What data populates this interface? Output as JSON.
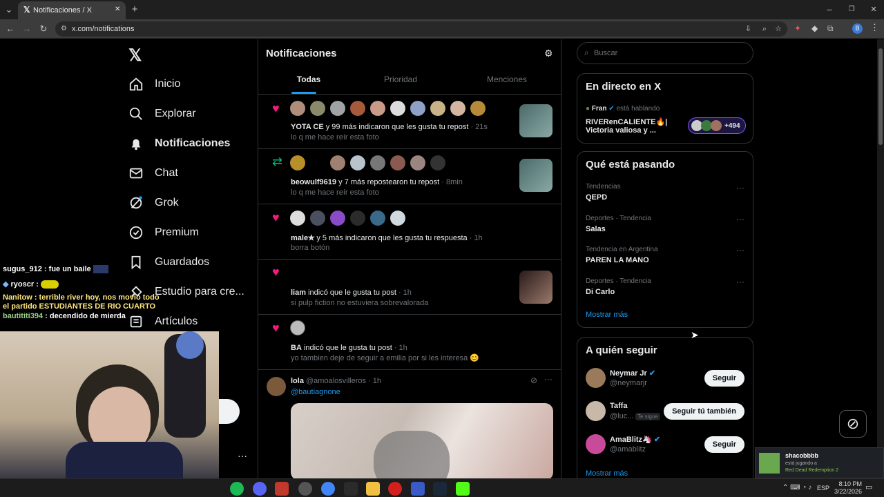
{
  "browser": {
    "tab_title": "Notificaciones / X",
    "url": "x.com/notifications",
    "new_tab": "+",
    "close": "✕"
  },
  "nav": {
    "items": [
      {
        "label": "Inicio",
        "icon": "home-icon"
      },
      {
        "label": "Explorar",
        "icon": "search-icon"
      },
      {
        "label": "Notificaciones",
        "icon": "bell-icon"
      },
      {
        "label": "Chat",
        "icon": "mail-icon"
      },
      {
        "label": "Grok",
        "icon": "grok-icon"
      },
      {
        "label": "Premium",
        "icon": "verified-icon"
      },
      {
        "label": "Guardados",
        "icon": "bookmark-icon"
      },
      {
        "label": "Estudio para cre...",
        "icon": "studio-icon"
      },
      {
        "label": "Artículos",
        "icon": "article-icon"
      }
    ],
    "more": "···"
  },
  "main": {
    "title": "Notificaciones",
    "tabs": [
      "Todas",
      "Prioridad",
      "Menciones"
    ],
    "notifications": [
      {
        "type": "like",
        "name": "YOTA CE",
        "rest": " y 99 más indicaron que les gusta tu repost",
        "time": " · 21s",
        "sub": "lo q me hace reír esta foto"
      },
      {
        "type": "repost",
        "name": "beowulf9619",
        "rest": " y 7 más repostearon tu repost",
        "time": " · 8min",
        "sub": "lo q me hace reír esta foto"
      },
      {
        "type": "like",
        "name": "male✯",
        "rest": " y 5 más indicaron que les gusta tu respuesta",
        "time": " · 1h",
        "sub": "borra botón"
      },
      {
        "type": "like",
        "name": "liam",
        "rest": " indicó que le gusta tu post",
        "time": " · 1h",
        "sub": "si pulp fiction no estuviera sobrevalorada"
      },
      {
        "type": "like",
        "name": "BA",
        "rest": " indicó que le gusta tu post",
        "time": " · 1h",
        "sub": "yo tambien deje de seguir a emilia por si les interesa 😊"
      }
    ],
    "post": {
      "name": "lola",
      "handle": "@amoalosvilleros",
      "time": " · 1h",
      "mention": "@bautiagnone"
    }
  },
  "right": {
    "search_placeholder": "Buscar",
    "live": {
      "title": "En directo en X",
      "host": "Fran",
      "status": "está hablando",
      "line1": "RIVERenCALIENTE🔥|",
      "line2": "Victoria valiosa y ...",
      "count": "+494"
    },
    "trends": {
      "title": "Qué está pasando",
      "items": [
        {
          "meta": "Tendencias",
          "name": "QEPD"
        },
        {
          "meta": "Deportes · Tendencia",
          "name": "Salas"
        },
        {
          "meta": "Tendencia en Argentina",
          "name": "PAREN LA MANO"
        },
        {
          "meta": "Deportes · Tendencia",
          "name": "Di Carlo"
        }
      ],
      "more": "Mostrar más"
    },
    "follow": {
      "title": "A quién seguir",
      "items": [
        {
          "name": "Neymar Jr",
          "handle": "@neymarjr",
          "button": "Seguir",
          "badge": ""
        },
        {
          "name": "Taffa",
          "handle": "@luc...",
          "button": "Seguir tú también",
          "badge": "Te sigue"
        },
        {
          "name": "AmaBlitz🦄",
          "handle": "@amablitz",
          "button": "Seguir",
          "badge": ""
        }
      ],
      "more": "Mostrar más"
    }
  },
  "chat_overlay": [
    {
      "user": "sugus_912",
      "msg": " : fue un baile",
      "color": "#ffffff"
    },
    {
      "user": "ryoscr",
      "msg": " :",
      "color": "#ffffff"
    },
    {
      "user": "Nanitow",
      "msg": " : terrible river hoy, nos movio todo el partido ESTUDIANTES DE RIO CUARTO",
      "color": "#ffe680"
    },
    {
      "user": "bautititi394",
      "msg": " : decendido de mierda",
      "color": "#9ad28a"
    }
  ],
  "steam": {
    "user": "shacobbbb",
    "status": "está jugando a",
    "game": "Red Dead Redemption 2"
  },
  "taskbar": {
    "lang": "ESP",
    "time": "8:10 PM",
    "date": "3/22/2026"
  }
}
